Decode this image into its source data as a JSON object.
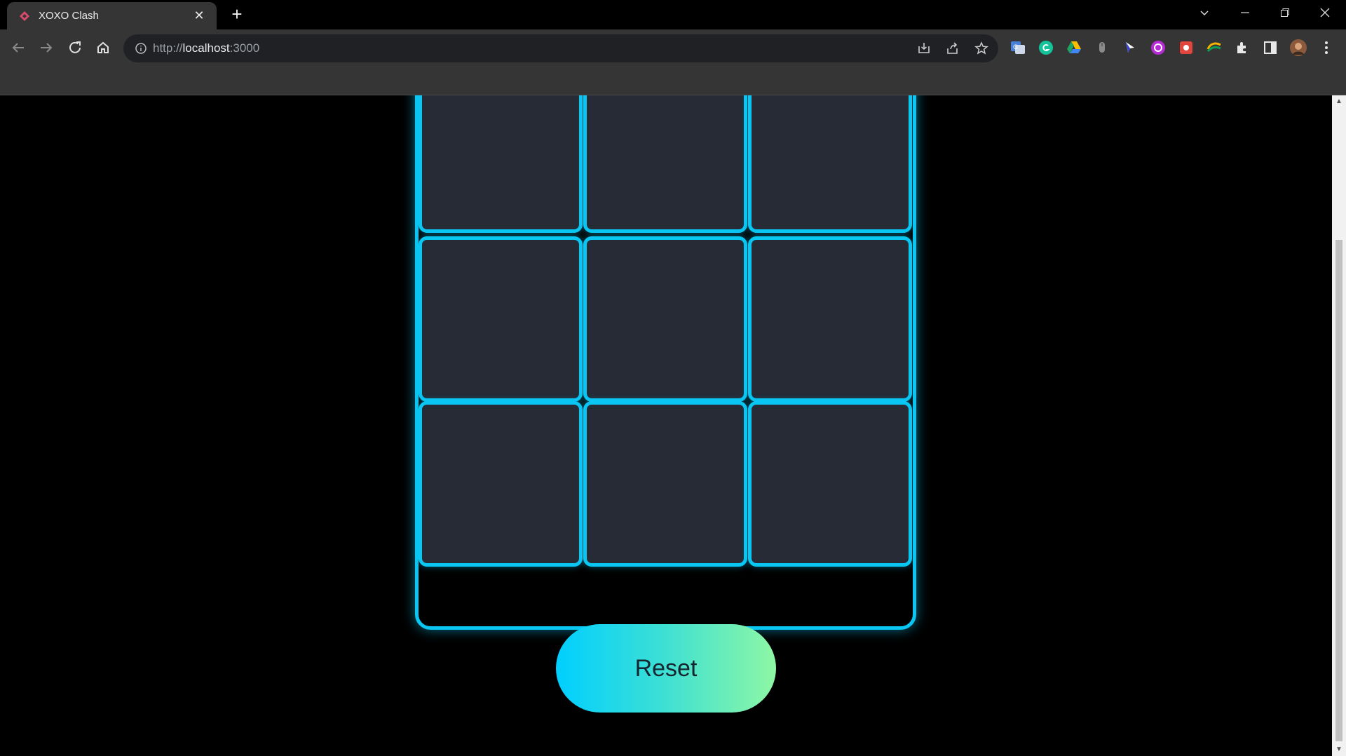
{
  "browser": {
    "tab_title": "XOXO Clash",
    "url_scheme": "http://",
    "url_host": "localhost",
    "url_port": ":3000"
  },
  "game": {
    "cells": [
      "",
      "",
      "",
      "",
      "",
      "",
      "",
      "",
      ""
    ],
    "reset_label": "Reset"
  },
  "colors": {
    "neon": "#0ac6f2",
    "cell_bg": "#262b36",
    "gradient_start": "#00cfff",
    "gradient_end": "#8ef7a4"
  }
}
